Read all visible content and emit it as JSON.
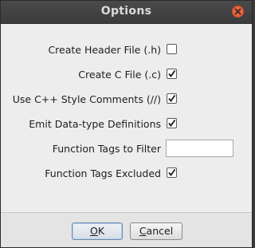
{
  "dialog": {
    "title": "Options"
  },
  "options": [
    {
      "label": "Create Header File (.h)",
      "type": "checkbox",
      "checked": false
    },
    {
      "label": "Create C File (.c)",
      "type": "checkbox",
      "checked": true
    },
    {
      "label": "Use C++ Style Comments (//)",
      "type": "checkbox",
      "checked": true
    },
    {
      "label": "Emit Data-type Definitions",
      "type": "checkbox",
      "checked": true
    },
    {
      "label": "Function Tags to Filter",
      "type": "text",
      "value": ""
    },
    {
      "label": "Function Tags Excluded",
      "type": "checkbox",
      "checked": true
    }
  ],
  "buttons": {
    "ok": {
      "mnemonic": "O",
      "rest": "K"
    },
    "cancel": {
      "mnemonic": "C",
      "rest": "ancel"
    }
  },
  "icons": {
    "close": "close-icon",
    "check": "checkmark-icon"
  },
  "colors": {
    "titlebar": "#3c3c3c",
    "close_button": "#e8623d",
    "background": "#ededed"
  }
}
